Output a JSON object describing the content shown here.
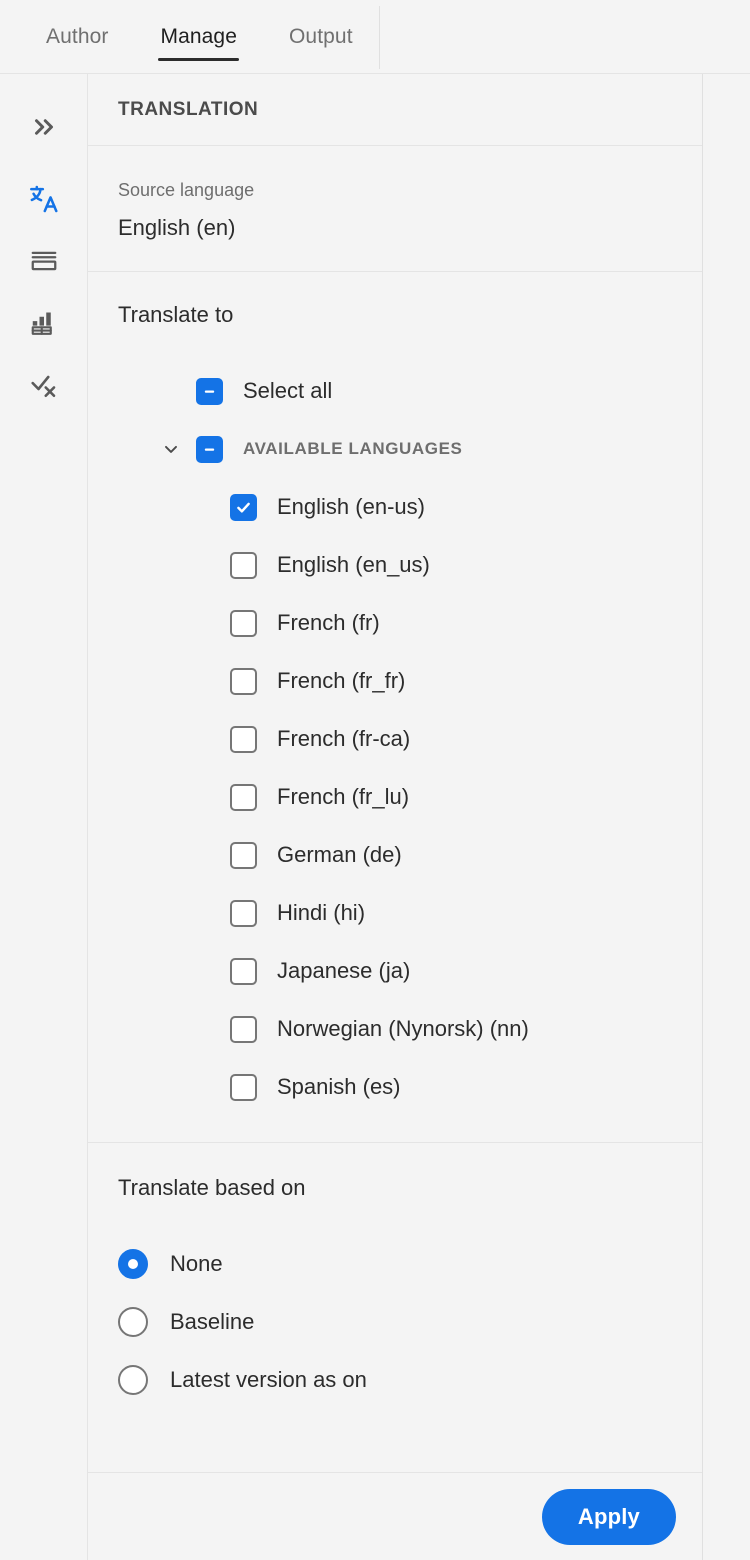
{
  "tabs": [
    {
      "label": "Author",
      "active": false
    },
    {
      "label": "Manage",
      "active": true
    },
    {
      "label": "Output",
      "active": false
    }
  ],
  "rail": {
    "items": [
      {
        "name": "expand-panel-icon",
        "icon": "double-chevron-right",
        "active": false
      },
      {
        "name": "translation-icon",
        "icon": "translate",
        "active": true
      },
      {
        "name": "conditions-icon",
        "icon": "list-lines",
        "active": false
      },
      {
        "name": "reports-icon",
        "icon": "bar-chart-table",
        "active": false
      },
      {
        "name": "review-icon",
        "icon": "check-x",
        "active": false
      }
    ]
  },
  "panel": {
    "title": "TRANSLATION",
    "source": {
      "label": "Source language",
      "value": "English (en)"
    },
    "translate_to": {
      "label": "Translate to",
      "select_all": {
        "label": "Select all",
        "state": "mixed"
      },
      "group": {
        "label": "AVAILABLE LANGUAGES",
        "state": "mixed",
        "expanded": true,
        "chevron": "chevron-down"
      },
      "languages": [
        {
          "label": "English (en-us)",
          "checked": true
        },
        {
          "label": "English (en_us)",
          "checked": false
        },
        {
          "label": "French (fr)",
          "checked": false
        },
        {
          "label": "French (fr_fr)",
          "checked": false
        },
        {
          "label": "French (fr-ca)",
          "checked": false
        },
        {
          "label": "French (fr_lu)",
          "checked": false
        },
        {
          "label": "German (de)",
          "checked": false
        },
        {
          "label": "Hindi (hi)",
          "checked": false
        },
        {
          "label": "Japanese (ja)",
          "checked": false
        },
        {
          "label": "Norwegian (Nynorsk) (nn)",
          "checked": false
        },
        {
          "label": "Spanish (es)",
          "checked": false
        }
      ]
    },
    "based_on": {
      "label": "Translate based on",
      "options": [
        {
          "label": "None",
          "selected": true
        },
        {
          "label": "Baseline",
          "selected": false
        },
        {
          "label": "Latest version as on",
          "selected": false
        }
      ]
    },
    "footer": {
      "apply_label": "Apply"
    }
  },
  "colors": {
    "accent": "#1473e6",
    "background": "#f4f4f4",
    "text": "#2c2c2c",
    "muted": "#6e6e6e",
    "border": "#e4e4e4"
  }
}
